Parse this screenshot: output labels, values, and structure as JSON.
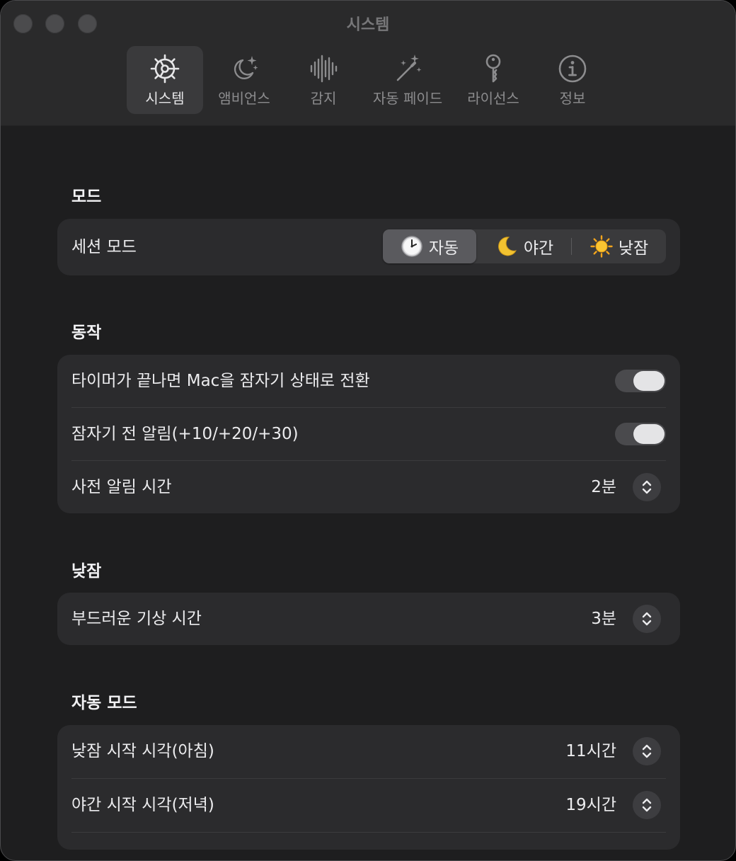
{
  "window": {
    "title": "시스템"
  },
  "toolbar": {
    "tabs": [
      {
        "label": "시스템",
        "icon": "gear-icon",
        "selected": true
      },
      {
        "label": "앰비언스",
        "icon": "moon-stars-icon",
        "selected": false
      },
      {
        "label": "감지",
        "icon": "waveform-icon",
        "selected": false
      },
      {
        "label": "자동 페이드",
        "icon": "magic-wand-icon",
        "selected": false
      },
      {
        "label": "라이선스",
        "icon": "key-icon",
        "selected": false
      },
      {
        "label": "정보",
        "icon": "info-icon",
        "selected": false
      }
    ]
  },
  "sections": {
    "mode": {
      "title": "모드",
      "session_mode": {
        "label": "세션 모드",
        "options": [
          {
            "label": "자동",
            "icon": "clock-icon",
            "selected": true
          },
          {
            "label": "야간",
            "icon": "crescent-moon-icon",
            "selected": false
          },
          {
            "label": "낮잠",
            "icon": "sun-icon",
            "selected": false
          }
        ]
      }
    },
    "behavior": {
      "title": "동작",
      "sleep_mac": {
        "label": "타이머가 끝나면 Mac을 잠자기 상태로 전환",
        "on": true
      },
      "pre_sleep_alert": {
        "label": "잠자기 전 알림(+10/+20/+30)",
        "on": true
      },
      "alert_lead_time": {
        "label": "사전 알림 시간",
        "value": "2분"
      }
    },
    "nap": {
      "title": "낮잠",
      "gentle_wake": {
        "label": "부드러운 기상 시간",
        "value": "3분"
      }
    },
    "auto_mode": {
      "title": "자동 모드",
      "nap_start": {
        "label": "낮잠 시작 시각(아침)",
        "value": "11시간"
      },
      "night_start": {
        "label": "야간 시작 시각(저녁)",
        "value": "19시간"
      }
    }
  },
  "colors": {
    "window_bg": "#1e1e1f",
    "toolbar_bg": "#2a2a2b",
    "card_bg": "#2b2b2d",
    "selected_tab_bg": "#3a3a3c",
    "text_primary": "#ececee",
    "text_secondary": "#8c8c8e"
  }
}
